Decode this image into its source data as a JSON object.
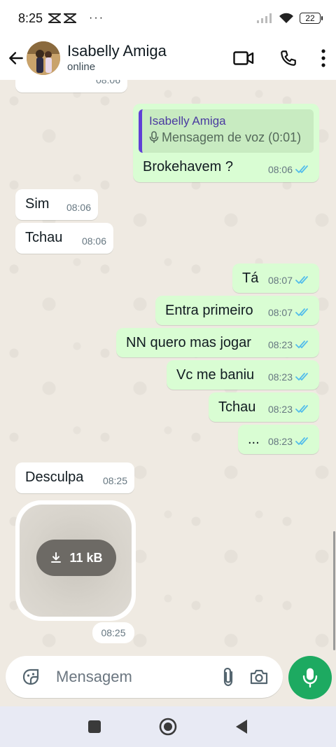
{
  "status_bar": {
    "time": "8:25",
    "more": "···",
    "battery": "22"
  },
  "header": {
    "contact_name": "Isabelly Amiga",
    "contact_status": "online"
  },
  "messages": [
    {
      "direction": "in",
      "text": "",
      "time": "08:06",
      "partial": true
    },
    {
      "direction": "out",
      "reply_to": {
        "name": "Isabelly Amiga",
        "preview": "Mensagem de voz (0:01)"
      },
      "text": "Brokehavem ?",
      "time": "08:06",
      "read": true
    },
    {
      "direction": "in",
      "text": "Sim",
      "time": "08:06"
    },
    {
      "direction": "in",
      "text": "Tchau",
      "time": "08:06"
    },
    {
      "direction": "out",
      "text": "Tá",
      "time": "08:07",
      "read": true
    },
    {
      "direction": "out",
      "text": "Entra primeiro",
      "time": "08:07",
      "read": true
    },
    {
      "direction": "out",
      "text": "NN quero mas jogar",
      "time": "08:23",
      "read": true
    },
    {
      "direction": "out",
      "text": "Vc me baniu",
      "time": "08:23",
      "read": true
    },
    {
      "direction": "out",
      "text": "Tchau",
      "time": "08:23",
      "read": true
    },
    {
      "direction": "out",
      "text": "...",
      "time": "08:23",
      "read": true
    },
    {
      "direction": "in",
      "text": "Desculpa",
      "time": "08:25"
    },
    {
      "direction": "in",
      "type": "media",
      "download_label": "11 kB",
      "time": "08:25"
    }
  ],
  "composer": {
    "placeholder": "Mensagem"
  },
  "colors": {
    "accent_green": "#1daa61",
    "outgoing_bubble": "#d9fdd3",
    "read_tick": "#53bdeb",
    "chat_bg": "#efeae2"
  }
}
